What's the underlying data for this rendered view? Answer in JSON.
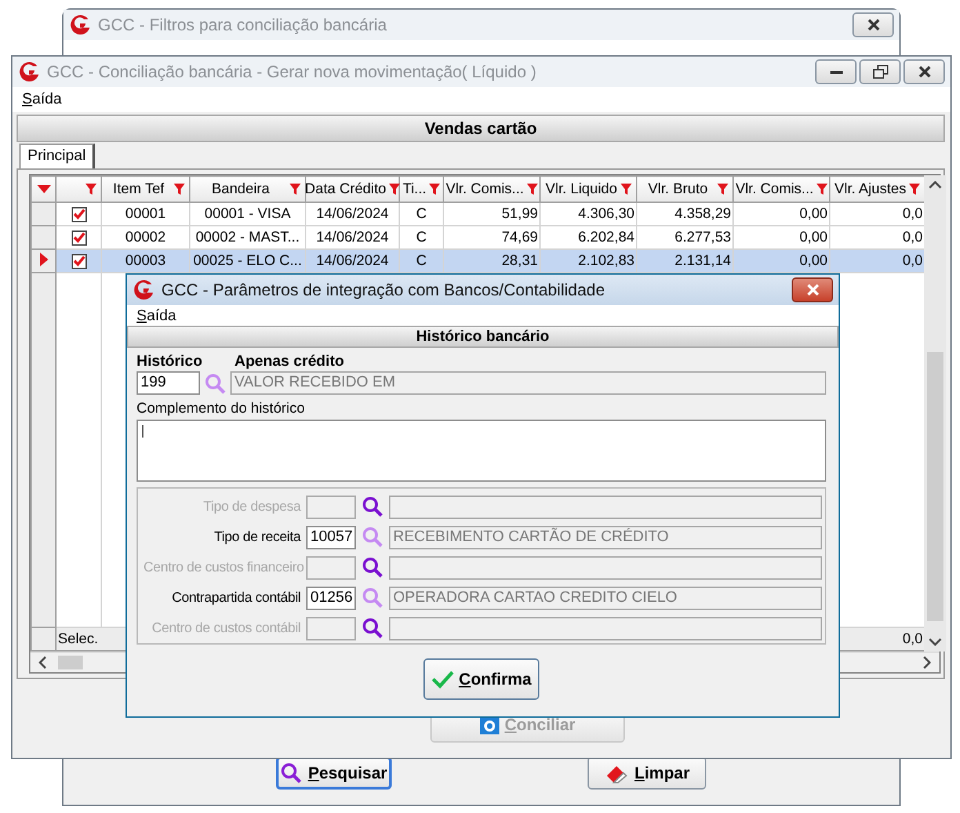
{
  "filter_window": {
    "title": "GCC - Filtros para conciliação bancária",
    "active": false,
    "buttons": [
      {
        "label": "Pesquisar",
        "focused": true
      },
      {
        "label": "Limpar",
        "focused": false
      }
    ]
  },
  "main_window": {
    "title": "GCC - Conciliação bancária - Gerar nova movimentação( Líquido )",
    "active": false,
    "menu": [
      "Saída"
    ],
    "section": "Vendas cartão",
    "tabs": [
      {
        "label": "Principal",
        "selected": true
      }
    ],
    "grid": {
      "columns": [
        {
          "kind": "text",
          "label": "Item Tef"
        },
        {
          "kind": "text",
          "label": "Bandeira"
        },
        {
          "kind": "text",
          "label": "Data Crédito"
        },
        {
          "kind": "text",
          "label": "Ti..."
        },
        {
          "kind": "number",
          "label": "Vlr. Comis..."
        },
        {
          "kind": "number",
          "label": "Vlr. Liquido"
        },
        {
          "kind": "number",
          "label": "Vlr. Bruto"
        },
        {
          "kind": "number",
          "label": "Vlr. Comis..."
        },
        {
          "kind": "number",
          "label": "Vlr. Ajustes"
        }
      ],
      "rows": [
        {
          "selected": false,
          "checked": true,
          "cells": [
            "00001",
            "00001 - VISA",
            "14/06/2024",
            "C",
            "51,99",
            "4.306,30",
            "4.358,29",
            "0,00",
            "0,0"
          ]
        },
        {
          "selected": false,
          "checked": true,
          "cells": [
            "00002",
            "00002 - MAST...",
            "14/06/2024",
            "C",
            "74,69",
            "6.202,84",
            "6.277,53",
            "0,00",
            "0,0"
          ]
        },
        {
          "selected": true,
          "checked": true,
          "cells": [
            "00003",
            "00025 - ELO C...",
            "14/06/2024",
            "C",
            "28,31",
            "2.102,83",
            "2.131,14",
            "0,00",
            "0,0"
          ]
        }
      ],
      "footer": {
        "label": "Selec.",
        "total": "0,0"
      }
    },
    "conciliar": {
      "label": "Conciliar",
      "disabled": true
    }
  },
  "dialog": {
    "title": "GCC - Parâmetros de integração com Bancos/Contabilidade",
    "active": true,
    "menu": [
      "Saída"
    ],
    "section": "Histórico bancário",
    "historico": {
      "label": "Histórico",
      "value": "199"
    },
    "apenas": {
      "label": "Apenas crédito",
      "value": "VALOR RECEBIDO EM"
    },
    "complemento": {
      "label": "Complemento do histórico"
    },
    "lookups": [
      {
        "label": "Tipo de despesa",
        "enabled": false
      },
      {
        "label": "Tipo de receita",
        "enabled": true,
        "code": "10057",
        "description": "RECEBIMENTO CARTÃO DE CRÉDITO"
      },
      {
        "label": "Centro de custos financeiro",
        "enabled": false
      },
      {
        "label": "Contrapartida contábil",
        "enabled": true,
        "code": "01256",
        "description": "OPERADORA CARTAO CREDITO CIELO"
      },
      {
        "label": "Centro de custos contábil",
        "enabled": false
      }
    ],
    "confirm": {
      "label": "Confirma"
    }
  }
}
